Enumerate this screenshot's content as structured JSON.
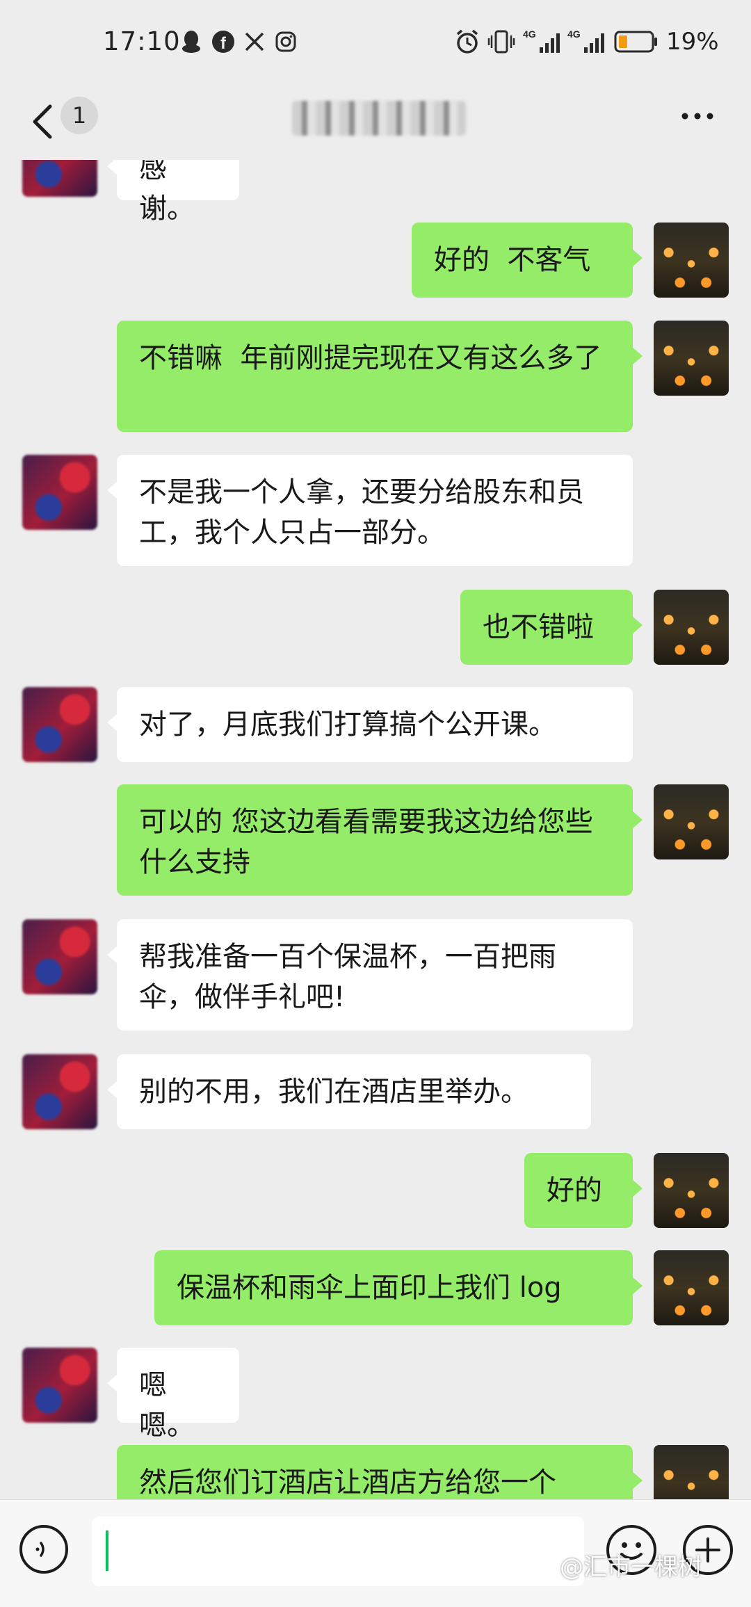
{
  "status_bar": {
    "time": "17:10",
    "left_icons": [
      "qq-icon",
      "facebook-icon",
      "x-icon",
      "instagram-icon"
    ],
    "right_icons": [
      "alarm-icon",
      "vibrate-icon",
      "signal-4g-icon",
      "signal-4g-icon",
      "battery-icon"
    ],
    "battery": "19%"
  },
  "header": {
    "unread_count": "1",
    "title": "",
    "back_icon": "chevron-left-icon",
    "more_icon": "more-icon"
  },
  "messages": [
    {
      "from": "them",
      "text": "感谢。"
    },
    {
      "from": "me",
      "text": "好的  不客气"
    },
    {
      "from": "me",
      "text": "不错嘛  年前刚提完现在又有这么多了"
    },
    {
      "from": "them",
      "text": "不是我一个人拿，还要分给股东和员工，我个人只占一部分。"
    },
    {
      "from": "me",
      "text": "也不错啦"
    },
    {
      "from": "them",
      "text": "对了，月底我们打算搞个公开课。"
    },
    {
      "from": "me",
      "text": "可以的 您这边看看需要我这边给您些什么支持"
    },
    {
      "from": "them",
      "text": "帮我准备一百个保温杯，一百把雨伞，做伴手礼吧!"
    },
    {
      "from": "them",
      "text": "别的不用，我们在酒店里举办。"
    },
    {
      "from": "me",
      "text": "好的"
    },
    {
      "from": "me",
      "text": "保温杯和雨伞上面印上我们 log"
    },
    {
      "from": "them",
      "text": "嗯嗯。"
    },
    {
      "from": "me",
      "text": "然后您们订酒店让酒店方给您一个"
    }
  ],
  "input_bar": {
    "voice_icon": "voice-icon",
    "emoji_icon": "emoji-icon",
    "plus_icon": "plus-icon"
  },
  "watermark": "@汇市一棵树",
  "colors": {
    "background": "#ededed",
    "my_bubble": "#95ec69",
    "their_bubble": "#ffffff",
    "caret": "#07c160",
    "battery_low": "#f39c12"
  }
}
